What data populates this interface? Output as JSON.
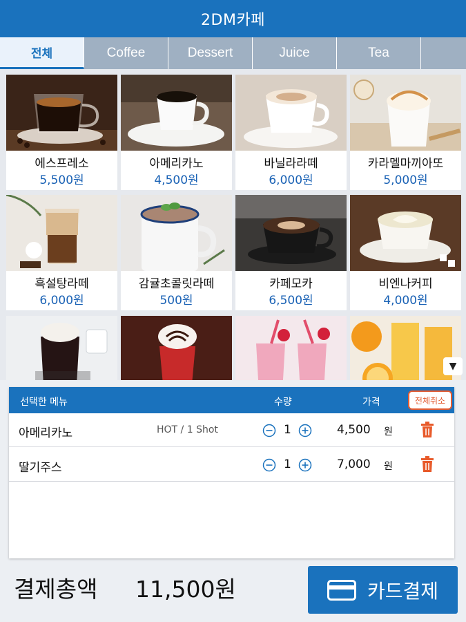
{
  "app": {
    "title": "2DM카페"
  },
  "tabs": [
    {
      "label": "전체",
      "active": true
    },
    {
      "label": "Coffee",
      "active": false
    },
    {
      "label": "Dessert",
      "active": false
    },
    {
      "label": "Juice",
      "active": false
    },
    {
      "label": "Tea",
      "active": false
    }
  ],
  "menu": [
    {
      "name": "에스프레소",
      "price": "5,500원",
      "icon": "espresso-photo"
    },
    {
      "name": "아메리카노",
      "price": "4,500원",
      "icon": "americano-photo"
    },
    {
      "name": "바닐라라떼",
      "price": "6,000원",
      "icon": "vanilla-latte-photo"
    },
    {
      "name": "카라멜마끼아또",
      "price": "5,000원",
      "icon": "caramel-macchiato-photo"
    },
    {
      "name": "흑설탕라떼",
      "price": "6,000원",
      "icon": "brown-sugar-latte-photo"
    },
    {
      "name": "감귤초콜릿라떼",
      "price": "500원",
      "icon": "tangerine-chocolate-latte-photo"
    },
    {
      "name": "카페모카",
      "price": "6,500원",
      "icon": "cafe-mocha-photo"
    },
    {
      "name": "비엔나커피",
      "price": "4,000원",
      "icon": "vienna-coffee-photo"
    }
  ],
  "menu_partial_icons": [
    "cold-brew-cream-photo",
    "chocolate-whip-drink-photo",
    "strawberry-smoothie-photo",
    "orange-juice-photo"
  ],
  "order": {
    "header": {
      "menu": "선택한 메뉴",
      "qty": "수량",
      "price": "가격",
      "clear": "전체취소"
    },
    "items": [
      {
        "name": "아메리카노",
        "option": "HOT / 1 Shot",
        "qty": "1",
        "price": "4,500",
        "unit": "원"
      },
      {
        "name": "딸기주스",
        "option": "",
        "qty": "1",
        "price": "7,000",
        "unit": "원"
      }
    ]
  },
  "footer": {
    "total_label": "결제총액",
    "total_value": "11,500원",
    "pay_label": "카드결제"
  },
  "colors": {
    "primary": "#1a72bd",
    "price_text": "#1a62b5",
    "danger": "#e25b31",
    "tab_inactive": "#9fb0c2"
  }
}
